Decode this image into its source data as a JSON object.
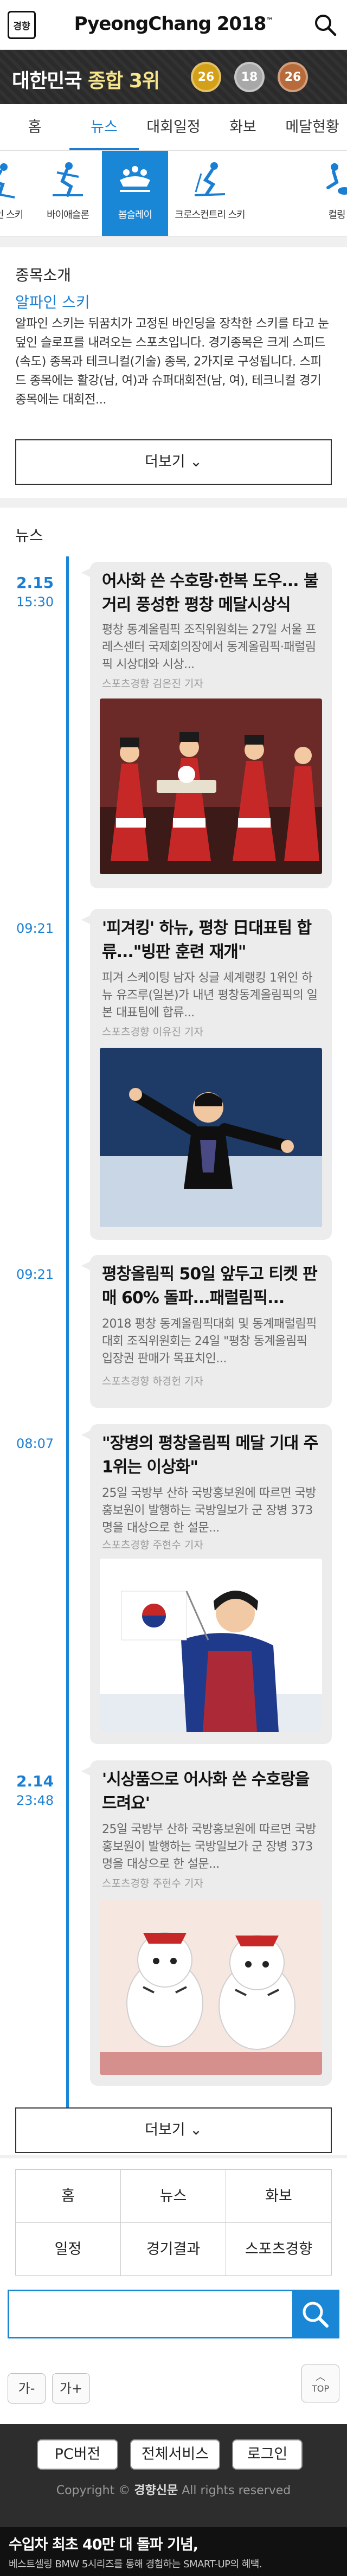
{
  "header": {
    "logo_text": "경향",
    "title": "PyeongChang 2018",
    "title_tm": "™"
  },
  "banner": {
    "country": "대한민국",
    "label_prefix": "종합",
    "rank": "3위",
    "gold": "26",
    "silver": "18",
    "bronze": "26"
  },
  "nav": {
    "items": [
      "홈",
      "뉴스",
      "대회일정",
      "화보",
      "메달현황"
    ],
    "active_index": 1
  },
  "sports": [
    {
      "label": "알파인 스키",
      "icon": "alpine-ski-icon"
    },
    {
      "label": "바이애슬론",
      "icon": "biathlon-icon"
    },
    {
      "label": "봅슬레이",
      "icon": "bobsleigh-icon"
    },
    {
      "label": "크로스컨트리 스키",
      "icon": "cross-country-ski-icon"
    },
    {
      "label": "컬링",
      "icon": "curling-icon"
    }
  ],
  "intro": {
    "title": "종목소개",
    "subtitle": "알파인 스키",
    "text": "알파인 스키는 뒤꿈치가 고정된 바인딩을 장착한 스키를 타고 눈 덮인 슬로프를 내려오는 스포츠입니다. 경기종목은 크게 스피드(속도) 종목과 테크니컬(기술) 종목, 2가지로 구성됩니다. 스피드 종목에는 활강(남, 여)과 슈퍼대회전(남, 여), 테크니컬 경기종목에는 대회전...",
    "more": "더보기"
  },
  "news": {
    "title": "뉴스",
    "items": [
      {
        "date": "2.15",
        "time": "15:30",
        "title": "어사화 쓴 수호랑·한복 도우... 불거리 풍성한 평창 메달시상식",
        "summary": "평창 동계올림픽 조직위원회는 27일 서울 프레스센터 국제회의장에서 동계올림픽·패럴림픽 시상대와 시상...",
        "byline": "스포츠경향 김은진 기자",
        "image": "medal-ceremony-photo"
      },
      {
        "date": "",
        "time": "09:21",
        "title": "'피겨킹' 하뉴, 평창 日대표팀 합류...\"빙판 훈련 재개\"",
        "summary": "피겨 스케이팅 남자 싱글 세계랭킹 1위인 하뉴 유즈루(일본)가 내년 평창동계올림픽의 일본 대표팀에 합류...",
        "byline": "스포츠경향 이유진 기자",
        "image": "figure-skater-photo"
      },
      {
        "date": "",
        "time": "09:21",
        "title": "평창올림픽 50일 앞두고 티켓 판매 60% 돌파...패럴림픽...",
        "summary": "2018 평창 동계올림픽대회 및 동계패럴림픽대회 조직위원회는 24일 \"평창 동계올림픽 입장권 판매가 목표치인...",
        "byline": "스포츠경향 하경헌 기자",
        "image": ""
      },
      {
        "date": "",
        "time": "08:07",
        "title": "\"장병의 평창올림픽 메달 기대 주 1위는 이상화\"",
        "summary": "25일 국방부 산하 국방홍보원에 따르면 국방홍보원이 발행하는 국방일보가 군 장병 373명을 대상으로 한 설문...",
        "byline": "스포츠경향 주현수 기자",
        "image": "speed-skater-photo"
      },
      {
        "date": "2.14",
        "time": "23:48",
        "title": "'시상품으로 어사화 쓴 수호랑을 드려요'",
        "summary": "25일 국방부 산하 국방홍보원에 따르면 국방홍보원이 발행하는 국방일보가 군 장병 373명을 대상으로 한 설문...",
        "byline": "스포츠경향 주현수 기자",
        "image": "soohorang-dolls-photo"
      }
    ],
    "more": "더보기"
  },
  "footer_menu": [
    "홈",
    "뉴스",
    "화보",
    "일정",
    "경기결과",
    "스포츠경향"
  ],
  "search": {
    "placeholder": ""
  },
  "font_controls": {
    "smaller": "가-",
    "larger": "가+",
    "top": "TOP"
  },
  "footer": {
    "buttons": [
      "PC버전",
      "전체서비스",
      "로그인"
    ],
    "copyright_prefix": "Copyright ©",
    "brand": "경향신문",
    "rights": "All rights reserved"
  },
  "ad": {
    "line1": "수입차 최초 40만 대 돌파 기념,",
    "line2": "베스트셀링 BMW 5시리즈를 통해 경험하는 SMART-UP의 혜택."
  },
  "colors": {
    "accent": "#1a86d6",
    "banner_bg": "#2b2b2b",
    "gold": "#d4a017",
    "silver": "#a8a8a8",
    "bronze": "#b86b3a"
  }
}
